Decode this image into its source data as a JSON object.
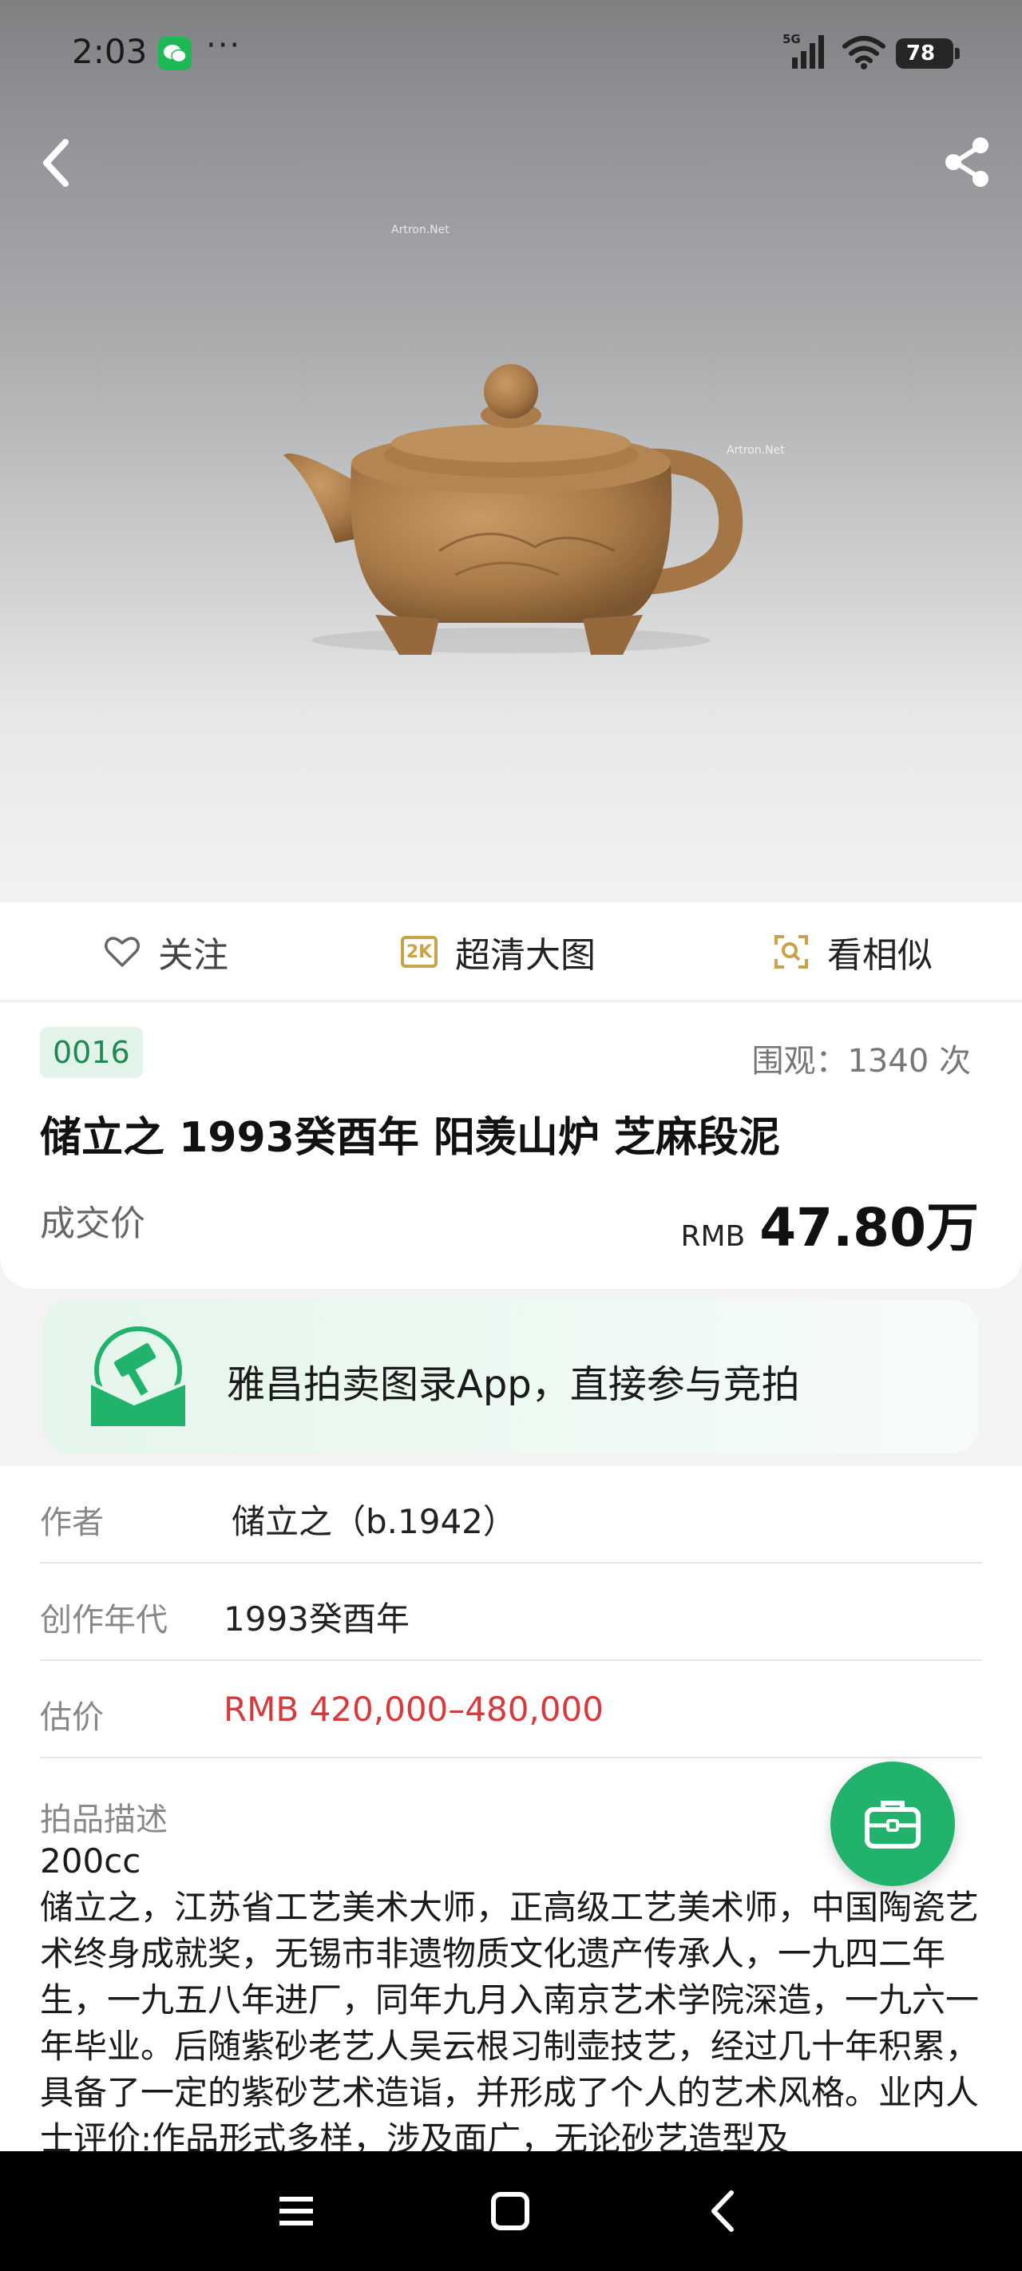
{
  "status_bar": {
    "time": "2:03",
    "more": "···",
    "network": "5G",
    "battery": "78"
  },
  "hero": {
    "watermark": "Artron.Net"
  },
  "actions": {
    "follow": "关注",
    "hd_badge": "2K",
    "hd": "超清大图",
    "similar": "看相似"
  },
  "lot": {
    "number": "0016",
    "views": "围观：1340  次",
    "title": "储立之 1993癸酉年 阳羡山炉  芝麻段泥",
    "deal_label": "成交价",
    "price_currency": "RMB",
    "price_value": "47.80万"
  },
  "banner": {
    "text": "雅昌拍卖图录App，直接参与竞拍"
  },
  "details": {
    "author_label": "作者",
    "author_value": "储立之（b.1942）",
    "year_label": "创作年代",
    "year_value": "1993癸酉年",
    "estimate_label": "估价",
    "estimate_value": "RMB  420,000–480,000",
    "desc_label": "拍品描述",
    "desc_size": "200cc",
    "desc_text": "储立之，江苏省工艺美术大师，正高级工艺美术师，中国陶瓷艺术终身成就奖，无锡市非遗物质文化遗产传承人，一九四二年生，一九五八年进厂，同年九月入南京艺术学院深造，一九六一年毕业。后随紫砂老艺人吴云根习制壶技艺，经过几十年积累，具备了一定的紫砂艺术造诣，并形成了个人的艺术风格。业内人士评价:作品形式多样，涉及面广，无论砂艺造型及"
  },
  "colors": {
    "accent_green": "#21b36b",
    "estimate_red": "#d8393a",
    "badge_gold": "#c9a24a"
  },
  "icons": [
    "wechat-icon",
    "signal-icon",
    "wifi-icon",
    "back-icon",
    "share-icon",
    "heart-icon",
    "2k-icon",
    "scan-similar-icon",
    "auction-logo-icon",
    "briefcase-icon",
    "menu-icon",
    "home-icon",
    "nav-back-icon"
  ]
}
